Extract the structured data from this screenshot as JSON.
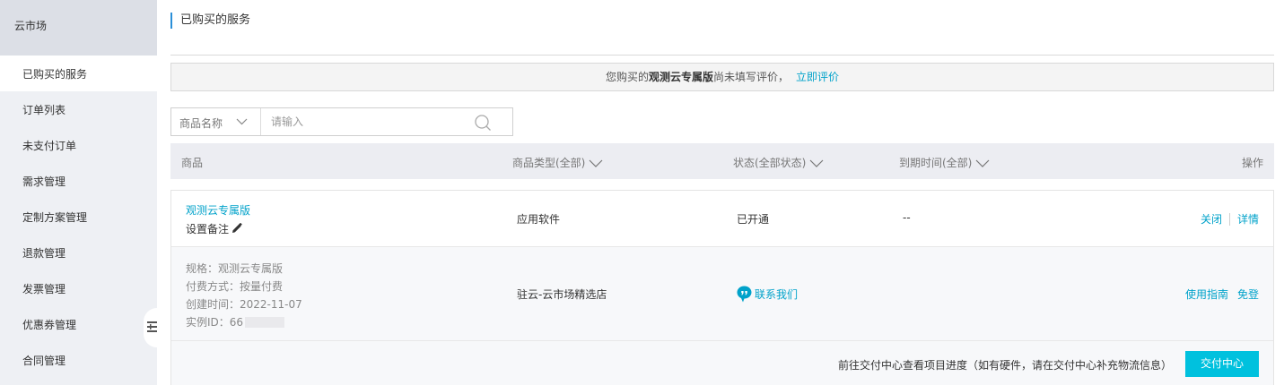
{
  "sidebar": {
    "title": "云市场",
    "items": [
      {
        "label": "已购买的服务"
      },
      {
        "label": "订单列表"
      },
      {
        "label": "未支付订单"
      },
      {
        "label": "需求管理"
      },
      {
        "label": "定制方案管理"
      },
      {
        "label": "退款管理"
      },
      {
        "label": "发票管理"
      },
      {
        "label": "优惠券管理"
      },
      {
        "label": "合同管理"
      }
    ],
    "active_index": 0
  },
  "header": {
    "title": "已购买的服务"
  },
  "notice": {
    "prefix": "您购买的",
    "product": "观测云专属版",
    "suffix": "尚未填写评价，",
    "link": "立即评价"
  },
  "search": {
    "field": "商品名称",
    "placeholder": "请输入"
  },
  "table": {
    "columns": {
      "product": "商品",
      "type": "商品类型(全部)",
      "status": "状态(全部状态)",
      "expiry": "到期时间(全部)",
      "action": "操作"
    },
    "rows": [
      {
        "name": "观测云专属版",
        "remark": "设置备注",
        "type": "应用软件",
        "status": "已开通",
        "expiry": "--",
        "actions": {
          "close": "关闭",
          "detail": "详情"
        },
        "details": {
          "spec": "规格：观测云专属版",
          "billing": "付费方式：按量付费",
          "created": "创建时间：2022-11-07",
          "instance": "实例ID：66"
        },
        "vendor": "驻云-云市场精选店",
        "contact": "联系我们",
        "guide": "使用指南",
        "login": "免登",
        "delivery_text": "前往交付中心查看项目进度（如有硬件，请在交付中心补充物流信息）",
        "delivery_button": "交付中心"
      }
    ]
  },
  "colors": {
    "accent": "#00a2ca",
    "button": "#00c1de",
    "sidebar_bg": "#eef0f4",
    "table_header_bg": "#ecedf2"
  }
}
